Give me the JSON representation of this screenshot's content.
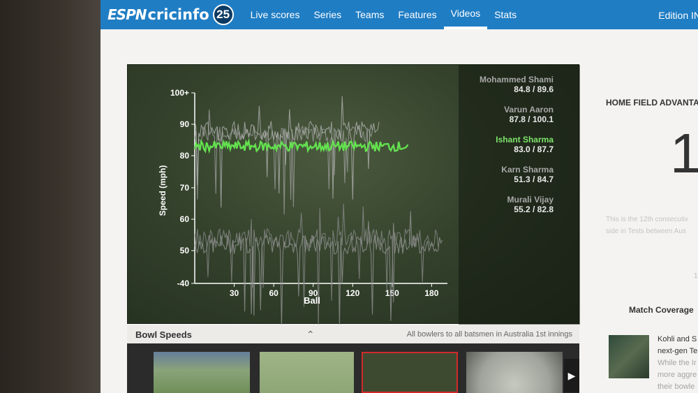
{
  "brand": {
    "wordmark": "ESPN",
    "name": "cricinfo",
    "badge": "25"
  },
  "nav": {
    "items": [
      "Live scores",
      "Series",
      "Teams",
      "Features",
      "Videos",
      "Stats"
    ],
    "active": "Videos",
    "edition": "Edition IN"
  },
  "chart_data": {
    "type": "line",
    "xlabel": "Ball",
    "ylabel": "Speed (mph)",
    "x_ticks": [
      30,
      60,
      90,
      120,
      150,
      180
    ],
    "y_ticks": [
      "-40",
      "50",
      "60",
      "70",
      "80",
      "90",
      "100+"
    ],
    "xlim": [
      0,
      192
    ],
    "grid": false,
    "legend_position": "right",
    "series": [
      {
        "name": "Mohammed Shami",
        "stat": "84.8 / 89.6",
        "color": "#a0a0a0",
        "x_range": [
          0,
          135
        ],
        "level": 87,
        "spread": 2.5
      },
      {
        "name": "Varun Aaron",
        "stat": "87.8 / 100.1",
        "color": "#b4b4b4",
        "x_range": [
          0,
          140
        ],
        "level": 88,
        "spread": 3
      },
      {
        "name": "Ishant Sharma",
        "stat": "83.0 / 87.7",
        "color": "#63e04f",
        "x_range": [
          0,
          162
        ],
        "level": 83,
        "spread": 1.6,
        "highlighted": true
      },
      {
        "name": "Karn Sharma",
        "stat": "51.3 / 84.7",
        "color": "#9a9a9a",
        "x_range": [
          0,
          188
        ],
        "level": 52,
        "spread": 3
      },
      {
        "name": "Murali Vijay",
        "stat": "55.2 / 82.8",
        "color": "#8c8c8c",
        "x_range": [
          0,
          185
        ],
        "level": 54,
        "spread": 3
      }
    ]
  },
  "bowl": {
    "title": "Bowl Speeds",
    "caret": "⌃",
    "note": "All bowlers to all batsmen in Australia 1st innings",
    "next": "▶"
  },
  "sidebar": {
    "hfa_title": "HOME FIELD ADVANTA",
    "hfa_number": "1",
    "hfa_line1": "This is the 12th consecutiv",
    "hfa_line2": "side in Tests between Aus",
    "hfa_small": "1",
    "match_coverage": "Match Coverage",
    "story_line1": "Kohli and S",
    "story_line2": "next-gen Te",
    "story_line3": "While the Ir",
    "story_line4": "more aggre",
    "story_line5": "their bowle"
  }
}
